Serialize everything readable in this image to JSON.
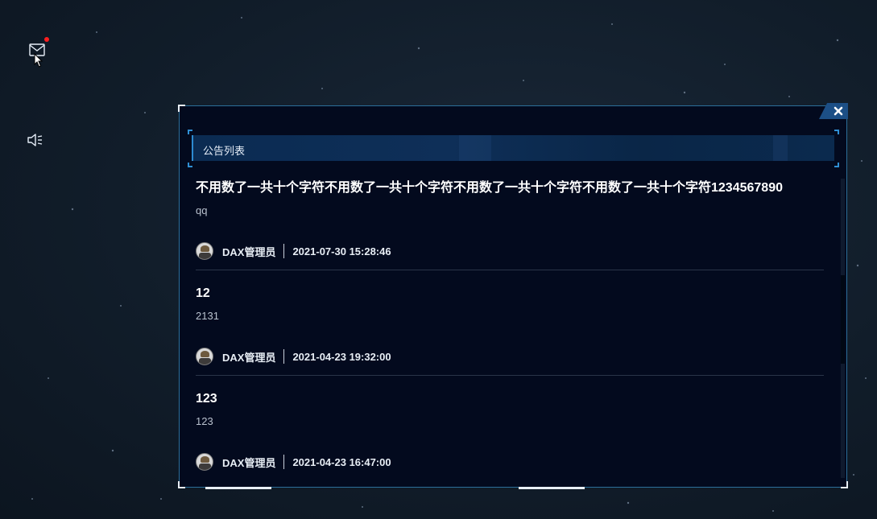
{
  "sidebar": {
    "mail_icon": "mail-icon",
    "has_unread": true,
    "unread_dot_color": "#ff1f1f",
    "speaker_icon": "speaker-icon"
  },
  "dialog": {
    "title": "公告列表",
    "close_icon": "close-icon",
    "accent_color": "#2d8ad0",
    "border_color": "#2c6f9a"
  },
  "announcements": [
    {
      "title": "不用数了一共十个字符不用数了一共十个字符不用数了一共十个字符不用数了一共十个字符1234567890",
      "body": "qq",
      "author": "DAX管理员",
      "time": "2021-07-30 15:28:46"
    },
    {
      "title": "12",
      "body": "2131",
      "author": "DAX管理员",
      "time": "2021-04-23 19:32:00"
    },
    {
      "title": "123",
      "body": "123",
      "author": "DAX管理员",
      "time": "2021-04-23 16:47:00"
    }
  ]
}
